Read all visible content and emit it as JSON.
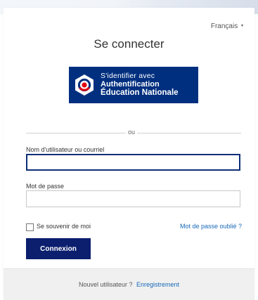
{
  "header": {
    "language": "Français",
    "language_caret": "▾"
  },
  "title": "Se connecter",
  "provider": {
    "line1": "S'identifier avec",
    "line2": "Authentification",
    "line3": "Éducation Nationale",
    "background": "#002f7f"
  },
  "separator": "ou",
  "form": {
    "username_label": "Nom d'utilisateur ou courriel",
    "username_value": "",
    "password_label": "Mot de passe",
    "password_value": "",
    "remember_label": "Se souvenir de moi",
    "remember_checked": false,
    "forgot_link": "Mot de passe oublié ?",
    "submit_label": "Connexion"
  },
  "footer": {
    "text": "Nouvel utilisateur ?",
    "register_link": "Enregistrement"
  },
  "colors": {
    "primary_button": "#0b1f6e",
    "link": "#1769b8",
    "focus_border": "#0e2e78"
  }
}
